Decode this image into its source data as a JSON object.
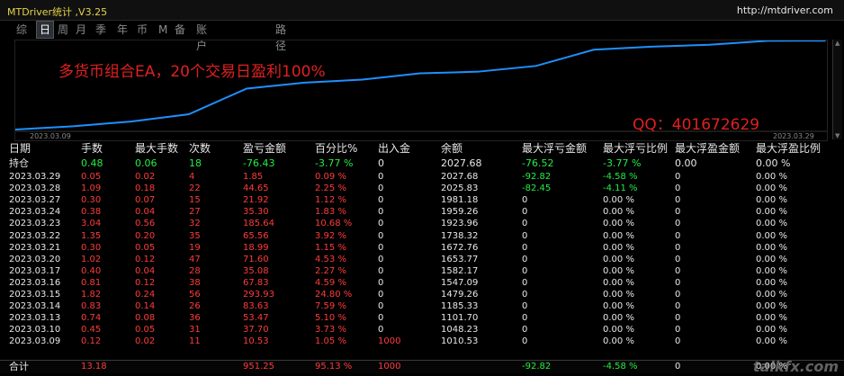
{
  "window": {
    "title": "MTDriver统计 ,V3.25",
    "url": "http://mtdriver.com"
  },
  "tabs": [
    "综",
    "日",
    "周",
    "月",
    "季",
    "年",
    "币",
    "M",
    "备",
    "账户",
    "路径"
  ],
  "active_tab": "日",
  "chart": {
    "annotation_main": "多货币组合EA，20个交易日盈利100%",
    "annotation_qq": "QQ：401672629",
    "start_date": "2023.03.09",
    "end_date": "2023.03.29",
    "line_color": "#1e90ff"
  },
  "chart_data": {
    "type": "line",
    "x": [
      "2023.03.09",
      "2023.03.10",
      "2023.03.13",
      "2023.03.14",
      "2023.03.15",
      "2023.03.16",
      "2023.03.17",
      "2023.03.20",
      "2023.03.21",
      "2023.03.22",
      "2023.03.23",
      "2023.03.24",
      "2023.03.27",
      "2023.03.28",
      "2023.03.29"
    ],
    "series": [
      {
        "values": [
          1010.53,
          1048.23,
          1101.7,
          1185.33,
          1479.26,
          1547.09,
          1582.17,
          1653.77,
          1672.76,
          1738.32,
          1923.96,
          1959.26,
          1981.18,
          2025.83,
          2027.68
        ]
      }
    ]
  },
  "table": {
    "headers": [
      "日期",
      "手数",
      "最大手数",
      "次数",
      "盈亏金额",
      "百分比%",
      "出入金",
      "余额",
      "最大浮亏金额",
      "最大浮亏比例",
      "最大浮盈金额",
      "最大浮盈比例"
    ],
    "holding": [
      "持仓",
      "0.48",
      "0.06",
      "18",
      "-76.43",
      "-3.77 %",
      "0",
      "2027.68",
      "-76.52",
      "-3.77 %",
      "0.00",
      "0.00 %"
    ],
    "rows": [
      [
        "2023.03.29",
        "0.05",
        "0.02",
        "4",
        "1.85",
        "0.09 %",
        "0",
        "2027.68",
        "-92.82",
        "-4.58 %",
        "0",
        "0.00 %"
      ],
      [
        "2023.03.28",
        "1.09",
        "0.18",
        "22",
        "44.65",
        "2.25 %",
        "0",
        "2025.83",
        "-82.45",
        "-4.11 %",
        "0",
        "0.00 %"
      ],
      [
        "2023.03.27",
        "0.30",
        "0.07",
        "15",
        "21.92",
        "1.12 %",
        "0",
        "1981.18",
        "0",
        "0.00 %",
        "0",
        "0.00 %"
      ],
      [
        "2023.03.24",
        "0.38",
        "0.04",
        "27",
        "35.30",
        "1.83 %",
        "0",
        "1959.26",
        "0",
        "0.00 %",
        "0",
        "0.00 %"
      ],
      [
        "2023.03.23",
        "3.04",
        "0.56",
        "32",
        "185.64",
        "10.68 %",
        "0",
        "1923.96",
        "0",
        "0.00 %",
        "0",
        "0.00 %"
      ],
      [
        "2023.03.22",
        "1.35",
        "0.20",
        "35",
        "65.56",
        "3.92 %",
        "0",
        "1738.32",
        "0",
        "0.00 %",
        "0",
        "0.00 %"
      ],
      [
        "2023.03.21",
        "0.30",
        "0.05",
        "19",
        "18.99",
        "1.15 %",
        "0",
        "1672.76",
        "0",
        "0.00 %",
        "0",
        "0.00 %"
      ],
      [
        "2023.03.20",
        "1.02",
        "0.12",
        "47",
        "71.60",
        "4.53 %",
        "0",
        "1653.77",
        "0",
        "0.00 %",
        "0",
        "0.00 %"
      ],
      [
        "2023.03.17",
        "0.40",
        "0.04",
        "28",
        "35.08",
        "2.27 %",
        "0",
        "1582.17",
        "0",
        "0.00 %",
        "0",
        "0.00 %"
      ],
      [
        "2023.03.16",
        "0.81",
        "0.12",
        "38",
        "67.83",
        "4.59 %",
        "0",
        "1547.09",
        "0",
        "0.00 %",
        "0",
        "0.00 %"
      ],
      [
        "2023.03.15",
        "1.82",
        "0.24",
        "56",
        "293.93",
        "24.80 %",
        "0",
        "1479.26",
        "0",
        "0.00 %",
        "0",
        "0.00 %"
      ],
      [
        "2023.03.14",
        "0.83",
        "0.14",
        "26",
        "83.63",
        "7.59 %",
        "0",
        "1185.33",
        "0",
        "0.00 %",
        "0",
        "0.00 %"
      ],
      [
        "2023.03.13",
        "0.74",
        "0.08",
        "36",
        "53.47",
        "5.10 %",
        "0",
        "1101.70",
        "0",
        "0.00 %",
        "0",
        "0.00 %"
      ],
      [
        "2023.03.10",
        "0.45",
        "0.05",
        "31",
        "37.70",
        "3.73 %",
        "0",
        "1048.23",
        "0",
        "0.00 %",
        "0",
        "0.00 %"
      ],
      [
        "2023.03.09",
        "0.12",
        "0.02",
        "11",
        "10.53",
        "1.05 %",
        "1000",
        "1010.53",
        "0",
        "0.00 %",
        "0",
        "0.00 %"
      ]
    ],
    "total": [
      "合计",
      "13.18",
      "",
      "",
      "951.25",
      "95.13 %",
      "1000",
      "",
      "-92.82",
      "-4.58 %",
      "0",
      "0.00 %"
    ]
  },
  "watermark": "talkfx.com"
}
